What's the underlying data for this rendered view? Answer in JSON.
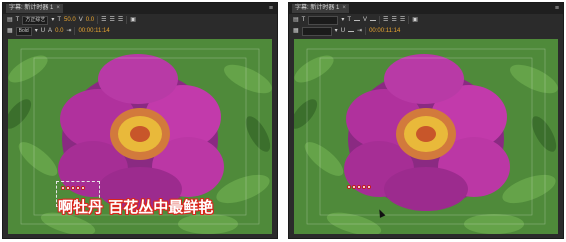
{
  "panels": [
    {
      "tab_title": "字幕: 新计时器 1",
      "font_select": "方正综艺",
      "font_style": "Bold",
      "size_a": "50.0",
      "size_b": "0.0",
      "size_c": "0.0",
      "timecode": "00:00:11:14",
      "caption": "啊牡丹  百花丛中最鲜艳",
      "show_caption": true
    },
    {
      "tab_title": "字幕: 新计时器 1",
      "font_select": "",
      "font_style": "",
      "size_a": "",
      "size_b": "",
      "size_c": "",
      "timecode": "00:00:11:14",
      "caption": "",
      "show_caption": false
    }
  ],
  "colors": {
    "panel_bg": "#2b2b2b",
    "accent": "#e8a531",
    "caption_stroke": "#d9261c",
    "flower": "#b0319d",
    "foliage": "#4f8a3a"
  },
  "icons": [
    "close-icon",
    "panel-menu-icon",
    "roll-crawl-icon",
    "bold-icon",
    "italic-icon",
    "underline-icon",
    "align-left-icon",
    "align-center-icon",
    "align-right-icon",
    "tab-stops-icon",
    "background-video-icon"
  ]
}
